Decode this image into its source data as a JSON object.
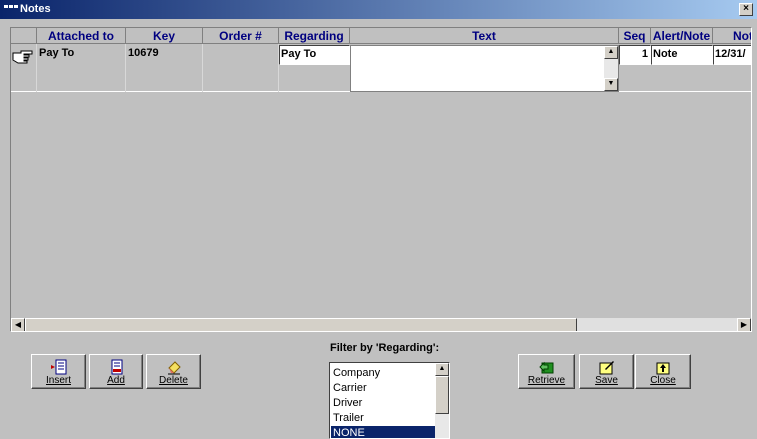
{
  "window": {
    "title": "Notes",
    "close_label": "×"
  },
  "grid": {
    "columns": [
      "",
      "Attached to",
      "Key",
      "Order #",
      "Regarding",
      "Text",
      "Seq",
      "Alert/Note",
      "Not"
    ],
    "rows": [
      {
        "attached_to": "Pay To",
        "key": "10679",
        "order": "",
        "regarding": "Pay To",
        "text": "",
        "seq": "1",
        "alert_note": "Note",
        "not": "12/31/"
      }
    ]
  },
  "buttons": {
    "insert": "Insert",
    "add": "Add",
    "delete": "Delete",
    "retrieve": "Retrieve",
    "save": "Save",
    "close": "Close"
  },
  "filter": {
    "label": "Filter by 'Regarding':",
    "options": [
      "Company",
      "Carrier",
      "Driver",
      "Trailer",
      "NONE"
    ],
    "selected": "NONE"
  },
  "icons": {
    "row_pointer": "pointing-hand-icon",
    "insert": "insert-row-icon",
    "add": "add-row-icon",
    "delete": "eraser-icon",
    "retrieve": "retrieve-icon",
    "save": "save-pencil-icon",
    "close": "close-folder-icon"
  },
  "colors": {
    "header_text": "#000080",
    "title_bar": "#0a246a",
    "selection": "#0a246a",
    "face": "#c0c0c0"
  }
}
